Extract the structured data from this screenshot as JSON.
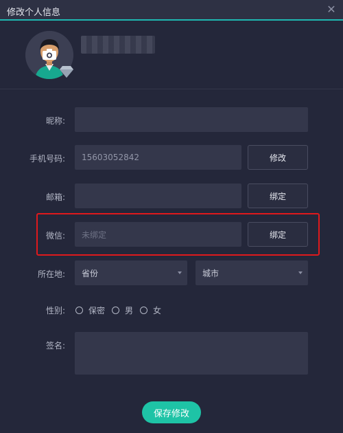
{
  "window": {
    "title": "修改个人信息",
    "close_icon": "close-icon"
  },
  "profile": {
    "username": ""
  },
  "form": {
    "nickname": {
      "label": "昵称:",
      "value": ""
    },
    "phone": {
      "label": "手机号码:",
      "value": "15603052842",
      "button": "修改"
    },
    "email": {
      "label": "邮箱:",
      "value": "",
      "button": "绑定"
    },
    "wechat": {
      "label": "微信:",
      "placeholder": "未绑定",
      "button": "绑定"
    },
    "location": {
      "label": "所在地:",
      "province": "省份",
      "city": "城市"
    },
    "gender": {
      "label": "性别:",
      "options": [
        "保密",
        "男",
        "女"
      ]
    },
    "signature": {
      "label": "签名:",
      "value": ""
    }
  },
  "actions": {
    "save": "保存修改"
  },
  "colors": {
    "accent": "#1fb8b2",
    "save": "#1ec3a6",
    "highlight": "#e0191c",
    "background": "#24273a"
  }
}
